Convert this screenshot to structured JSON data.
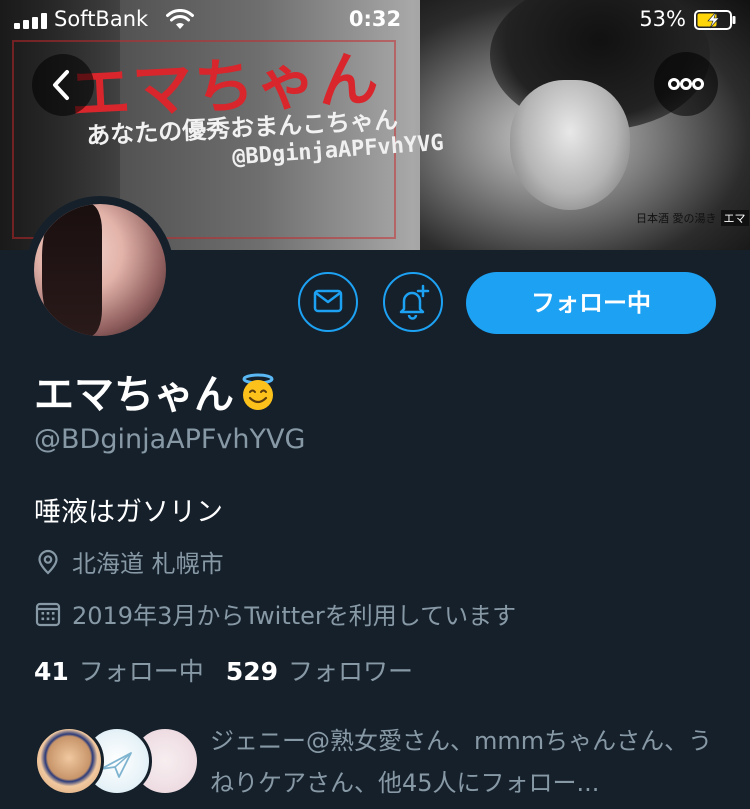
{
  "status_bar": {
    "carrier": "SoftBank",
    "time": "0:32",
    "battery_percent": "53%"
  },
  "banner": {
    "title": "エマちゃん",
    "subtitle": "あなたの優秀おまんこちゃん",
    "handle": "@BDginjaAPFvhYVG",
    "watermark_text": "日本酒 愛の湯き",
    "watermark_box": "エマ"
  },
  "profile": {
    "display_name": "エマちゃん",
    "name_emoji": "😇",
    "handle": "@BDginjaAPFvhYVG",
    "bio": "唾液はガソリン",
    "location": "北海道 札幌市",
    "joined": "2019年3月からTwitterを利用しています",
    "following_count": "41",
    "following_label": "フォロー中",
    "followers_count": "529",
    "followers_label": "フォロワー",
    "known_followers": "ジェニー@熟女愛さん、mmmちゃんさん、うねりケアさん、他45人にフォロー..."
  },
  "actions": {
    "follow_button": "フォロー中"
  },
  "icons": {
    "back": "chevron-left-icon",
    "more": "more-icon",
    "message": "envelope-icon",
    "notify": "bell-plus-icon",
    "location": "location-pin-icon",
    "calendar": "calendar-icon"
  },
  "colors": {
    "background": "#15202b",
    "accent": "#1da1f2",
    "secondary_text": "#8899a6",
    "banner_title": "#d8262c"
  }
}
